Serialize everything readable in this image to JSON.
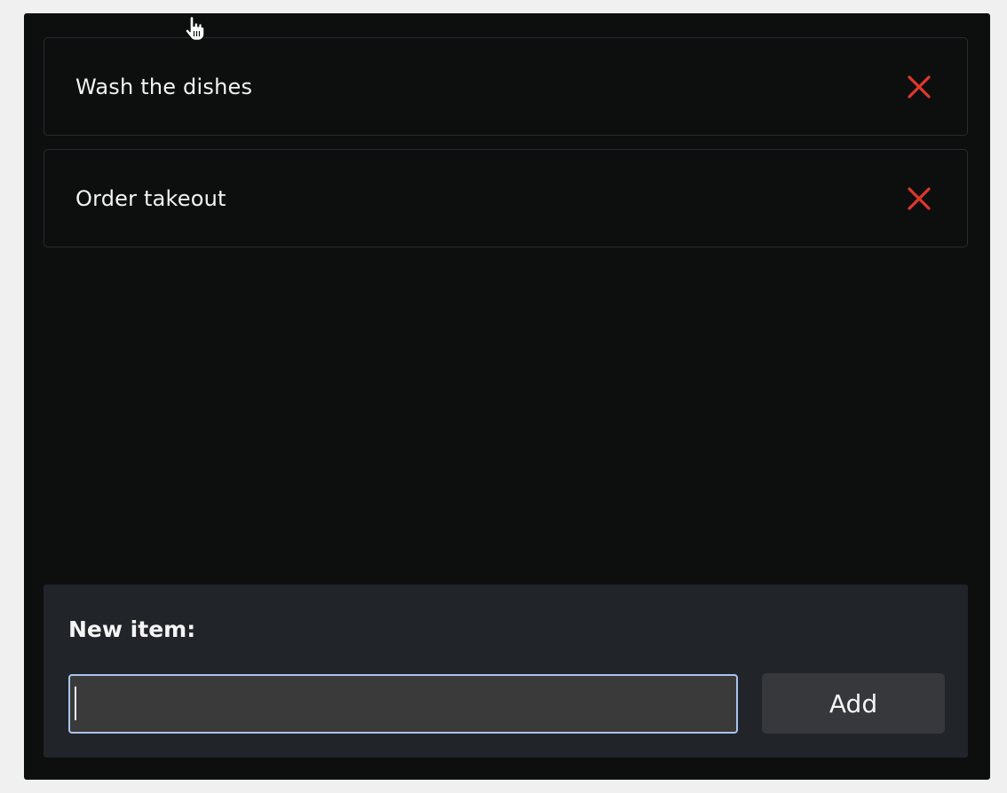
{
  "todos": [
    {
      "text": "Wash the dishes"
    },
    {
      "text": "Order takeout"
    }
  ],
  "new_item": {
    "label": "New item:",
    "input_value": "",
    "add_label": "Add"
  },
  "colors": {
    "background": "#0d0f0f",
    "item_border": "#262c33",
    "delete_icon": "#e0362c",
    "panel_bg": "#212428",
    "input_bg": "#3a3a3a",
    "input_focus_border": "#a8c4ee",
    "button_bg": "#36383c"
  },
  "icons": {
    "delete": "close-icon",
    "cursor": "hand-pointer-icon"
  }
}
